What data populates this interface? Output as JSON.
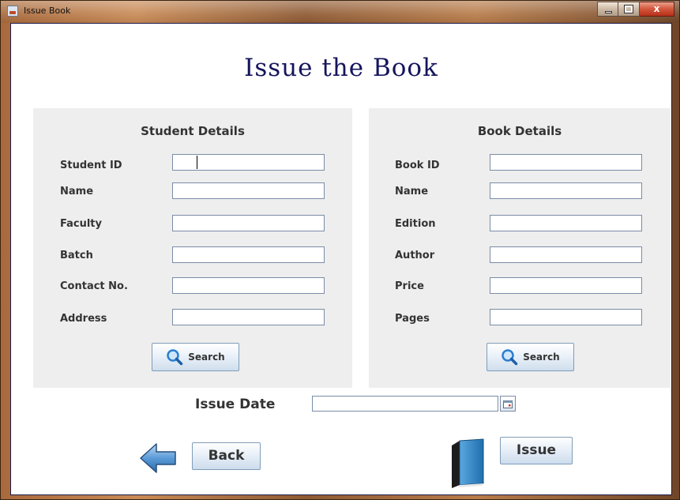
{
  "window": {
    "title": "Issue Book",
    "close_glyph": "x"
  },
  "heading": "Issue the Book",
  "student_panel": {
    "title": "Student Details",
    "fields": [
      {
        "label": "Student ID",
        "value": ""
      },
      {
        "label": "Name",
        "value": ""
      },
      {
        "label": "Faculty",
        "value": ""
      },
      {
        "label": "Batch",
        "value": ""
      },
      {
        "label": "Contact No.",
        "value": ""
      },
      {
        "label": "Address",
        "value": ""
      }
    ],
    "search_label": "Search"
  },
  "book_panel": {
    "title": "Book Details",
    "fields": [
      {
        "label": "Book ID",
        "value": ""
      },
      {
        "label": "Name",
        "value": ""
      },
      {
        "label": "Edition",
        "value": ""
      },
      {
        "label": "Author",
        "value": ""
      },
      {
        "label": "Price",
        "value": ""
      },
      {
        "label": "Pages",
        "value": ""
      }
    ],
    "search_label": "Search"
  },
  "issue_date": {
    "label": "Issue Date",
    "value": ""
  },
  "actions": {
    "back_label": "Back",
    "issue_label": "Issue"
  },
  "icons": {
    "app": "java-cup-icon",
    "search": "magnifier-icon",
    "calendar": "calendar-icon",
    "back": "left-arrow-icon",
    "book": "book-icon"
  },
  "colors": {
    "heading": "#15155c",
    "panel_bg": "#eeeeee",
    "input_border": "#7a8ca6",
    "button_border": "#7f9db9",
    "book_blue": "#2f86c9"
  }
}
